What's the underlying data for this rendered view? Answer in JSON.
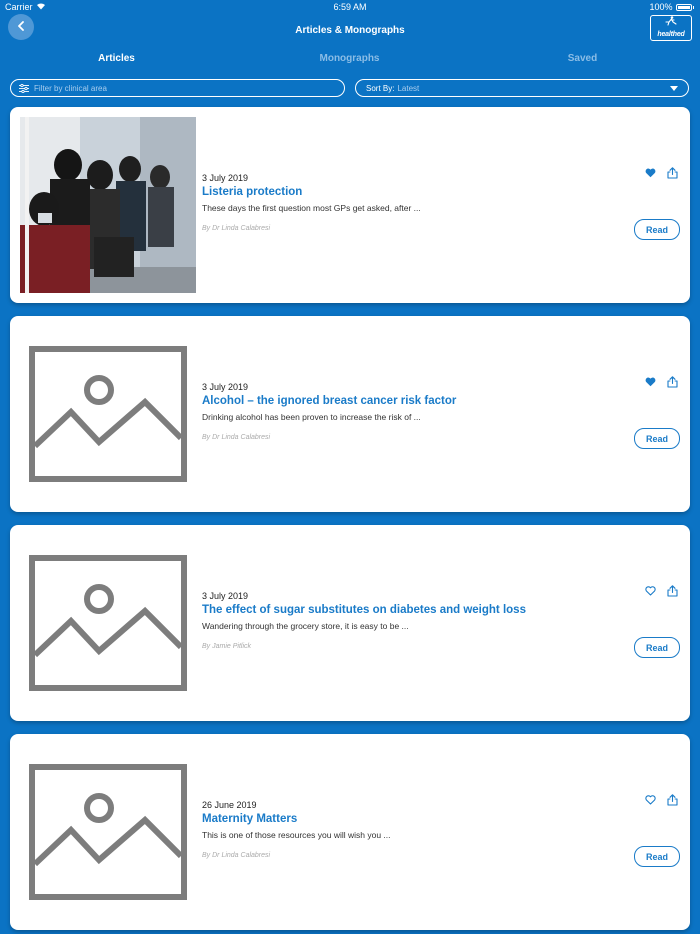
{
  "status": {
    "carrier": "Carrier",
    "time": "6:59 AM",
    "battery": "100%"
  },
  "nav": {
    "title": "Articles & Monographs",
    "logo_text": "healthed"
  },
  "tabs": [
    {
      "label": "Articles",
      "active": true
    },
    {
      "label": "Monographs",
      "active": false
    },
    {
      "label": "Saved",
      "active": false
    }
  ],
  "filters": {
    "clinical_placeholder": "Filter by clinical area",
    "sort_prefix": "Sort By:",
    "sort_value": "Latest"
  },
  "colors": {
    "background": "#0b73c4",
    "accent": "#1a7bc8",
    "card": "#ffffff",
    "placeholder_gray": "#7d7d7d"
  },
  "articles": [
    {
      "date": "3 July 2019",
      "title": "Listeria protection",
      "excerpt": "These days the first question most GPs get asked, after ...",
      "author": "By Dr Linda Calabresi",
      "saved": true,
      "image": "photo",
      "read_label": "Read"
    },
    {
      "date": "3 July 2019",
      "title": "Alcohol – the ignored breast cancer risk factor",
      "excerpt": "Drinking alcohol has been proven to increase the risk of ...",
      "author": "By Dr Linda Calabresi",
      "saved": true,
      "image": "placeholder",
      "read_label": "Read"
    },
    {
      "date": "3 July 2019",
      "title": "The effect of sugar substitutes on diabetes and weight loss",
      "excerpt": "Wandering through the grocery store, it is easy to be ...",
      "author": "By Jamie Pitlick",
      "saved": false,
      "image": "placeholder",
      "read_label": "Read"
    },
    {
      "date": "26 June 2019",
      "title": "Maternity Matters",
      "excerpt": "This is one of those resources you will wish you ...",
      "author": "By Dr Linda Calabresi",
      "saved": false,
      "image": "placeholder",
      "read_label": "Read"
    }
  ]
}
